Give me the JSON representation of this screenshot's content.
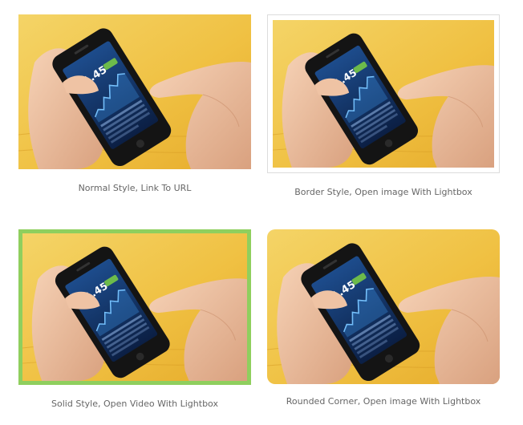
{
  "gallery": {
    "items": [
      {
        "caption": "Normal Style, Link To URL",
        "style": "normal",
        "phone_value": "71.45"
      },
      {
        "caption": "Border Style, Open image With Lightbox",
        "style": "border",
        "border_color": "#dcdcdc",
        "phone_value": "71.45"
      },
      {
        "caption": "Solid Style, Open Video With Lightbox",
        "style": "solid",
        "border_color": "#8fcf5e",
        "phone_value": "71.45"
      },
      {
        "caption": "Rounded Corner, Open image With Lightbox",
        "style": "rounded",
        "phone_value": "71.45"
      }
    ]
  }
}
